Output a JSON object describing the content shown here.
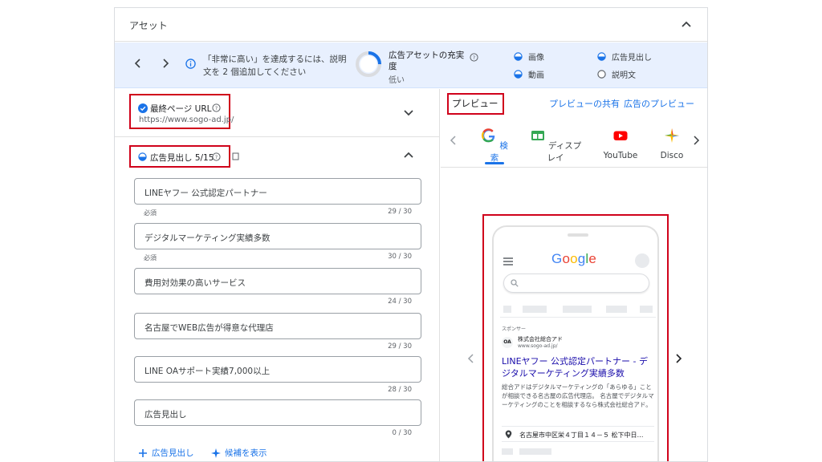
{
  "panel": {
    "title": "アセット"
  },
  "banner": {
    "message": "「非常に高い」を達成するには、説明文を 2 個追加してください",
    "strength_title": "広告アセットの充実度",
    "strength_level": "低い",
    "legend": [
      {
        "label": "画像",
        "state": "half"
      },
      {
        "label": "広告見出し",
        "state": "half"
      },
      {
        "label": "動画",
        "state": "half"
      },
      {
        "label": "説明文",
        "state": "empty"
      }
    ]
  },
  "final_url": {
    "label": "最終ページ URL",
    "value": "https://www.sogo-ad.jp/"
  },
  "headlines": {
    "title": "広告見出し 5/15",
    "required_label": "必須",
    "items": [
      {
        "text": "LINEヤフー 公式認定パートナー",
        "count": "29 / 30",
        "required": true
      },
      {
        "text": "デジタルマーケティング実績多数",
        "count": "30 / 30",
        "required": true
      },
      {
        "text": "費用対効果の高いサービス",
        "count": "24 / 30",
        "required": false
      },
      {
        "text": "名古屋でWEB広告が得意な代理店",
        "count": "29 / 30",
        "required": false
      },
      {
        "text": "LINE OAサポート実績7,000以上",
        "count": "28 / 30",
        "required": false
      },
      {
        "text": "広告見出し",
        "count": "0 / 30",
        "required": false,
        "placeholder": true
      }
    ],
    "add_label": "広告見出し",
    "suggest_label": "候補を表示"
  },
  "preview": {
    "title": "プレビュー",
    "share_label": "プレビューの共有",
    "ad_preview_label": "広告のプレビュー",
    "tabs": [
      {
        "label": "検索",
        "icon": "google-g-icon",
        "active": true
      },
      {
        "label": "ディスプレイ",
        "icon": "display-icon",
        "active": false
      },
      {
        "label": "YouTube",
        "icon": "youtube-icon",
        "active": false
      },
      {
        "label": "Disco",
        "icon": "discover-icon",
        "active": false
      }
    ]
  },
  "mock_ad": {
    "logo_text": "Google",
    "sponsored": "スポンサー",
    "advertiser_logo": "OA",
    "advertiser_name": "株式会社総合アド",
    "advertiser_url": "www.sogo-ad.jp/",
    "headline": "LINEヤフー 公式認定パートナー - デジタルマーケティング実績多数",
    "description": "総合アドはデジタルマーケティングの「あらゆる」ことが相談できる名古屋の広告代理店。 名古屋でデジタルマーケティングのことを相談するなら株式会社総合アド。",
    "address": "名古屋市中区栄４丁目１４－５ 松下中日…"
  },
  "colors": {
    "accent": "#1a73e8",
    "highlight_box": "#d0021b",
    "banner_bg": "#e8f0fe"
  }
}
